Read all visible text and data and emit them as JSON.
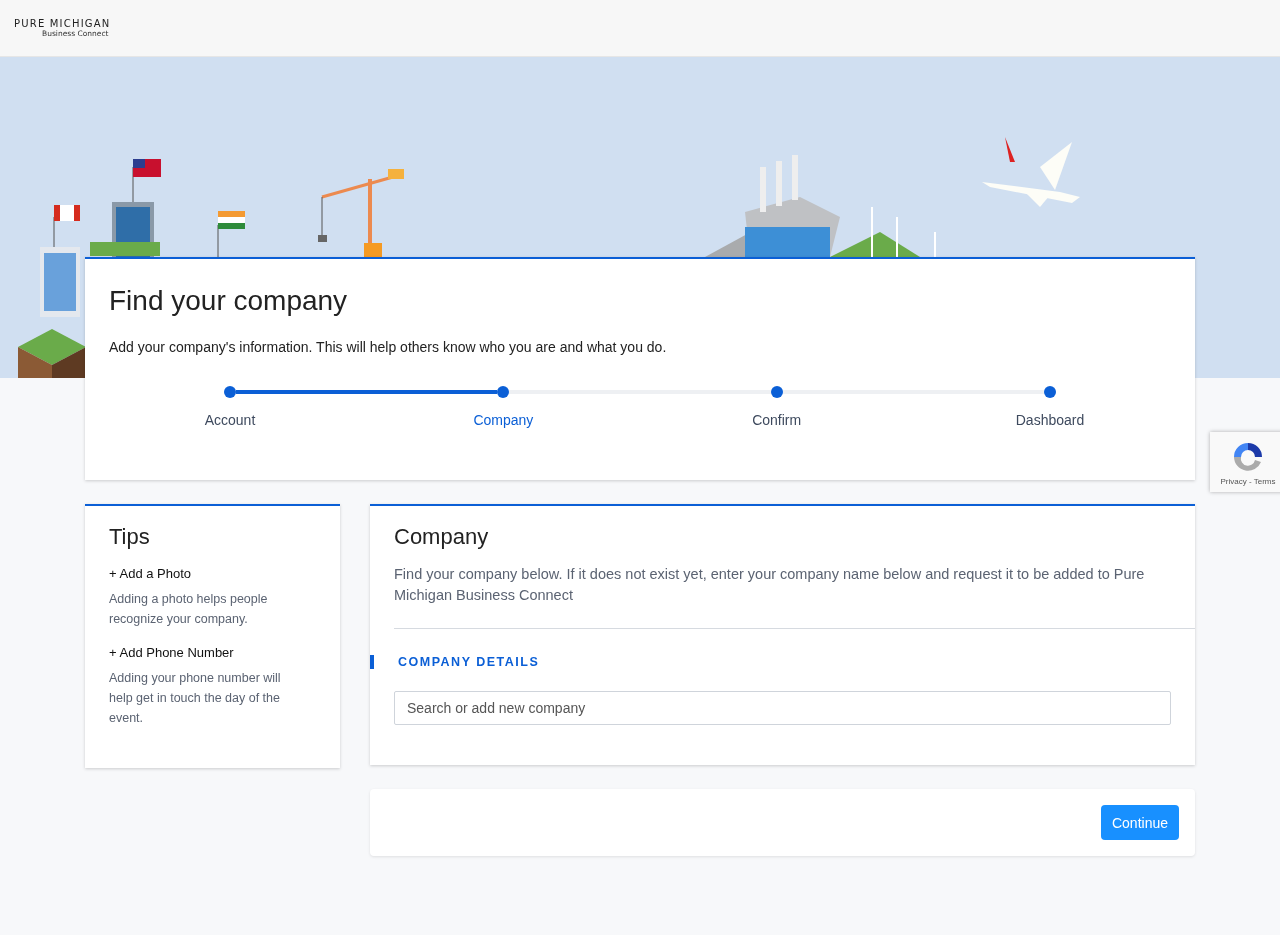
{
  "logo": {
    "brand": "PURE MICHIGAN",
    "sub": "Business Connect"
  },
  "intro": {
    "title": "Find your company",
    "text": "Add your company's information. This will help others know who you are and what you do."
  },
  "progress": {
    "steps": [
      {
        "label": "Account",
        "selected": false
      },
      {
        "label": "Company",
        "selected": true
      },
      {
        "label": "Confirm",
        "selected": false
      },
      {
        "label": "Dashboard",
        "selected": false
      }
    ]
  },
  "tips": {
    "title": "Tips",
    "items": [
      {
        "link": "+ Add a Photo",
        "text": "Adding a photo helps people recognize your company."
      },
      {
        "link": "+ Add Phone Number",
        "text": "Adding your phone number will help get in touch the day of the event."
      }
    ]
  },
  "company": {
    "title": "Company",
    "text": "Find your company below. If it does not exist yet, enter your company name below and request it to be added to Pure Michigan Business Connect",
    "section": "COMPANY DETAILS",
    "search": {
      "placeholder": "Search or add new company"
    }
  },
  "buttons": [
    "Continue"
  ],
  "recaptcha": {
    "text": "Privacy - Terms"
  }
}
